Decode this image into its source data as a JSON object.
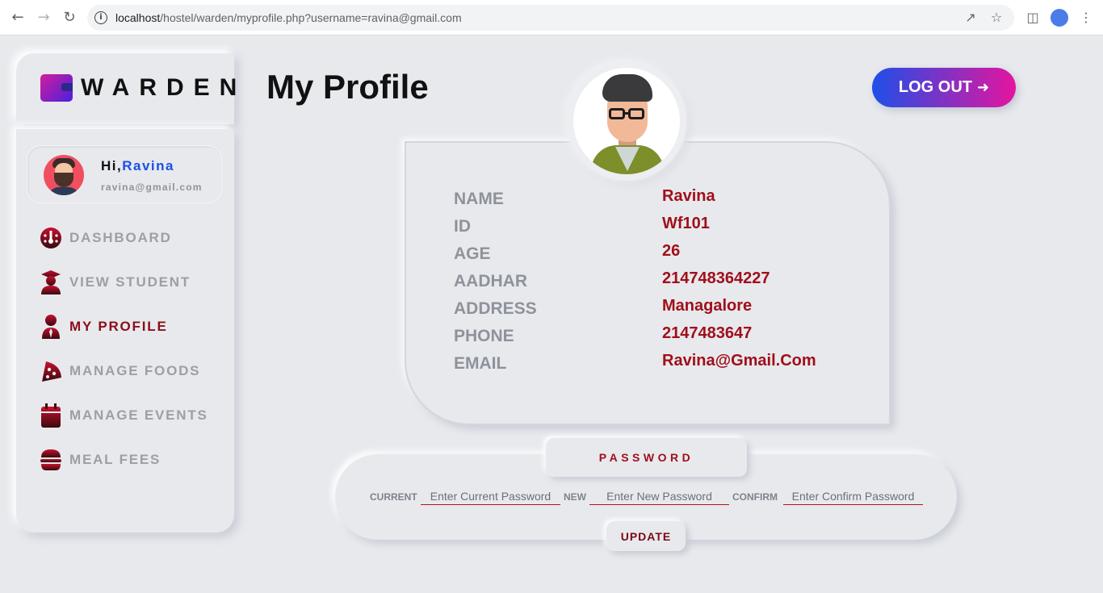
{
  "browser": {
    "url_host": "localhost",
    "url_path": "/hostel/warden/myprofile.php?username=ravina@gmail.com",
    "back_icon": "arrow-left-icon",
    "forward_icon": "arrow-right-icon",
    "reload_icon": "reload-icon"
  },
  "brand": {
    "name": "WARDEN"
  },
  "user": {
    "greeting": "Hi,",
    "name": "Ravina",
    "email": "ravina@gmail.com"
  },
  "sidebar": {
    "items": [
      {
        "label": "DASHBOARD",
        "icon": "dashboard-gauge-icon",
        "active": false
      },
      {
        "label": "VIEW STUDENT",
        "icon": "graduate-icon",
        "active": false
      },
      {
        "label": "MY PROFILE",
        "icon": "user-tie-icon",
        "active": true
      },
      {
        "label": "MANAGE FOODS",
        "icon": "pizza-icon",
        "active": false
      },
      {
        "label": "MANAGE EVENTS",
        "icon": "calendar-icon",
        "active": false
      },
      {
        "label": "MEAL FEES",
        "icon": "hamburger-icon",
        "active": false
      }
    ]
  },
  "header": {
    "title": "My Profile",
    "logout_label": "LOG OUT"
  },
  "profile": {
    "fields": [
      {
        "label": "NAME",
        "value": "Ravina"
      },
      {
        "label": "ID",
        "value": "Wf101"
      },
      {
        "label": "AGE",
        "value": "26"
      },
      {
        "label": "AADHAR",
        "value": "214748364227"
      },
      {
        "label": "ADDRESS",
        "value": "Managalore"
      },
      {
        "label": "PHONE",
        "value": "2147483647"
      },
      {
        "label": "EMAIL",
        "value": "Ravina@Gmail.Com"
      }
    ]
  },
  "password": {
    "title": "PASSWORD",
    "current_label": "CURRENT",
    "current_placeholder": "Enter Current Password",
    "new_label": "NEW",
    "new_placeholder": "Enter New Password",
    "confirm_label": "CONFIRM",
    "confirm_placeholder": "Enter Confirm Password",
    "update_label": "UPDATE"
  },
  "colors": {
    "accent_red": "#a00f1a",
    "accent_blue": "#1d4fe8",
    "accent_pink": "#e4159f",
    "background": "#e7e9ed"
  }
}
